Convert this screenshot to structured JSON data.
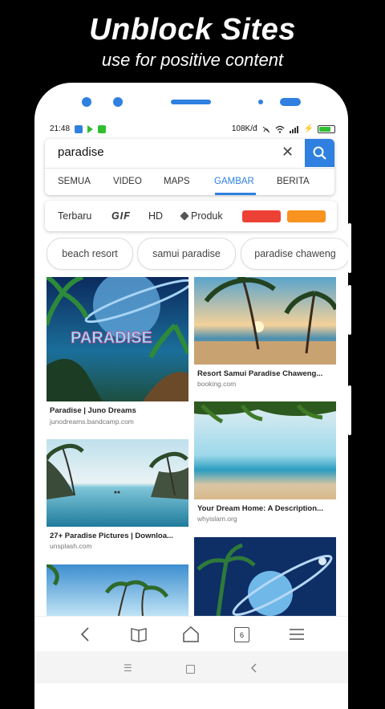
{
  "promo": {
    "headline": "Unblock Sites",
    "subline": "use for positive content"
  },
  "status": {
    "time": "21:48",
    "net_speed": "108K/đ",
    "icons": [
      "notification-icon",
      "play-icon",
      "app-icon"
    ]
  },
  "search": {
    "query": "paradise"
  },
  "tabs": [
    "SEMUA",
    "VIDEO",
    "MAPS",
    "GAMBAR",
    "BERITA"
  ],
  "active_tab": "GAMBAR",
  "filters": {
    "terbaru": "Terbaru",
    "gif": "GIF",
    "hd": "HD",
    "produk": "Produk",
    "colors": [
      "#ee4136",
      "#f7931e"
    ]
  },
  "chips": [
    "beach resort",
    "samui paradise",
    "paradise chaweng"
  ],
  "results": [
    {
      "caption": "Paradise | Juno Dreams",
      "source": "junodreams.bandcamp.com",
      "art": "PARADISE"
    },
    {
      "caption": "Resort Samui Paradise Chaweng...",
      "source": "booking.com"
    },
    {
      "caption": "27+ Paradise Pictures | Downloa...",
      "source": "unsplash.com"
    },
    {
      "caption": "Your Dream Home: A Description...",
      "source": "whyislam.org"
    }
  ],
  "bottom_nav": {
    "tab_count": "6"
  },
  "colors": {
    "accent": "#2f80e0",
    "background": "#000000"
  }
}
